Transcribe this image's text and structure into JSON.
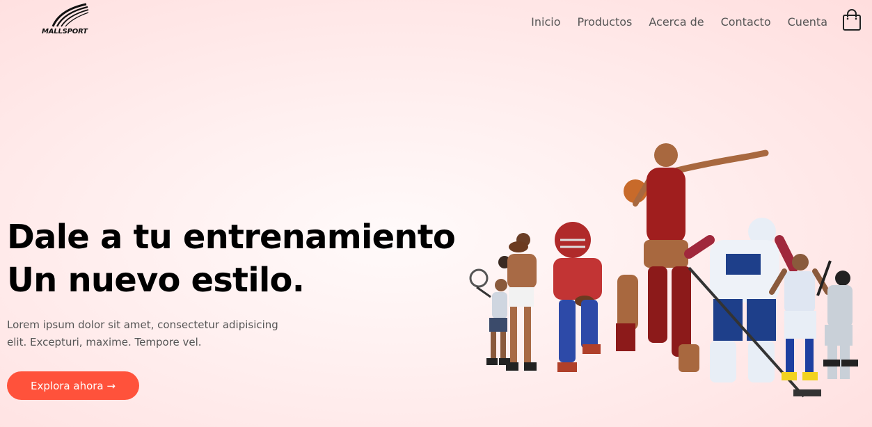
{
  "brand": {
    "logo_text": "MALLSPORT"
  },
  "nav": {
    "items": [
      {
        "label": "Inicio"
      },
      {
        "label": "Productos"
      },
      {
        "label": "Acerca de"
      },
      {
        "label": "Contacto"
      },
      {
        "label": "Cuenta"
      }
    ],
    "cart_icon": "shopping-bag-icon"
  },
  "hero": {
    "title_line1": "Dale a tu entrenamiento",
    "title_line2": "Un nuevo estilo.",
    "description": "Lorem ipsum dolor sit amet, consectetur adipisicing elit. Excepturi, maxime. Tempore vel.",
    "cta_label": "Explora ahora →",
    "image": "athletes-collage"
  },
  "colors": {
    "accent": "#ff523b",
    "background_top": "#ffdede",
    "background_center": "#fffafa",
    "text_dark": "#000000",
    "text_muted": "#555555"
  }
}
